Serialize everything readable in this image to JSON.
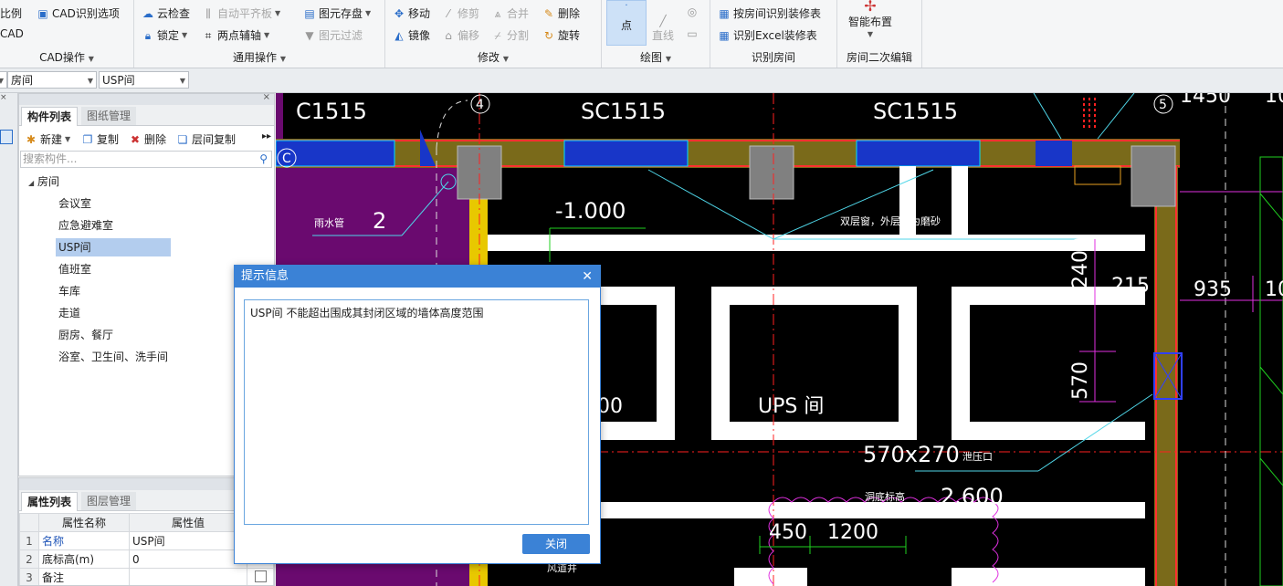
{
  "ribbon": {
    "groups": {
      "cad_ops": {
        "label": "CAD操作",
        "scale": "比例",
        "cad_options": "CAD识别选项",
        "cad_clear": "CAD"
      },
      "common_ops": {
        "label": "通用操作",
        "cloud_check": "云检查",
        "auto_align": "自动平齐板",
        "lock": "锁定",
        "two_point": "两点辅轴",
        "save_element": "图元存盘",
        "element_filter": "图元过滤"
      },
      "modify": {
        "label": "修改",
        "move": "移动",
        "trim": "修剪",
        "merge": "合并",
        "delete": "删除",
        "mirror": "镜像",
        "offset": "偏移",
        "split": "分割",
        "rotate": "旋转"
      },
      "draw": {
        "label": "绘图",
        "point": "点",
        "line": "直线"
      },
      "recognize_room": {
        "label": "识别房间",
        "by_room": "按房间识别装修表",
        "excel": "识别Excel装修表"
      },
      "room_edit": {
        "label": "房间二次编辑",
        "smart_layout": "智能布置"
      }
    }
  },
  "toolbar2": {
    "combo1": "房间",
    "combo2": "USP间"
  },
  "component_panel": {
    "tab_active": "构件列表",
    "tab_inactive": "图纸管理",
    "tools": {
      "new": "新建",
      "copy": "复制",
      "delete": "删除",
      "floor_copy": "层间复制"
    },
    "search_placeholder": "搜索构件...",
    "tree_root": "房间",
    "tree_items": [
      "会议室",
      "应急避难室",
      "USP间",
      "值班室",
      "车库",
      "走道",
      "厨房、餐厅",
      "浴室、卫生间、洗手间"
    ]
  },
  "props_panel": {
    "tab_active": "属性列表",
    "tab_inactive": "图层管理",
    "col_name": "属性名称",
    "col_value": "属性值",
    "rows": [
      {
        "num": "1",
        "name": "名称",
        "value": "USP间"
      },
      {
        "num": "2",
        "name": "底标高(m)",
        "value": "0"
      },
      {
        "num": "3",
        "name": "备注",
        "value": ""
      }
    ]
  },
  "cad": {
    "labels": {
      "c1515": "C1515",
      "sc1515_a": "SC1515",
      "sc1515_b": "SC1515",
      "axis4": "4",
      "axis5": "5",
      "axisC": "C",
      "rain_pipe": "雨水管",
      "num2": "2",
      "elev": "-1.000",
      "double_window": "双层窗，外层窗为磨砂",
      "dim2400": "2400",
      "dim215": "215",
      "dim935": "935",
      "dim570": "570",
      "dim10a": "10",
      "dim10b": "10",
      "dim1450": "1450",
      "ups": "UPS 间",
      "dim570x270": "570x270",
      "relief": "泄压口",
      "top_elev": "洞底标高",
      "dim2600": "2.600",
      "dim450": "450",
      "dim1200": "1200",
      "partial_00": "00",
      "bottom_label": "风道井"
    }
  },
  "dialog": {
    "title": "提示信息",
    "message": "USP间 不能超出围成其封闭区域的墙体高度范围",
    "close_button": "关闭"
  }
}
